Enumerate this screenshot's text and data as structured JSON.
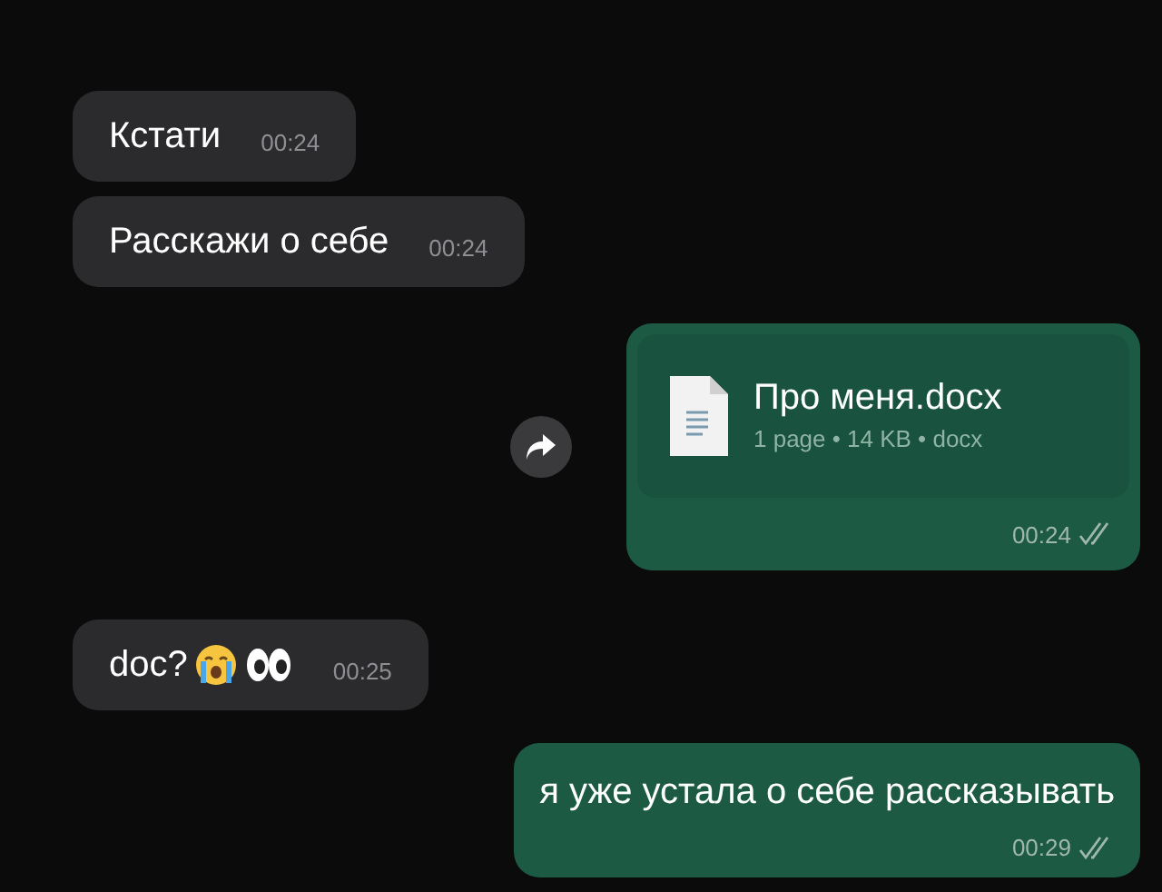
{
  "messages": [
    {
      "kind": "text",
      "outgoing": false,
      "text": "Кстати",
      "time": "00:24"
    },
    {
      "kind": "text",
      "outgoing": false,
      "text": "Расскажи о себе",
      "time": "00:24"
    },
    {
      "kind": "document",
      "outgoing": true,
      "forward": true,
      "file_name": "Про меня.docx",
      "details": "1 page • 14 KB • docx",
      "time": "00:24",
      "read": false
    },
    {
      "kind": "emoji_text",
      "outgoing": false,
      "text": "doc?",
      "time": "00:25"
    },
    {
      "kind": "text",
      "outgoing": true,
      "text": "я уже устала о себе рассказывать",
      "time": "00:29",
      "read": false
    }
  ]
}
